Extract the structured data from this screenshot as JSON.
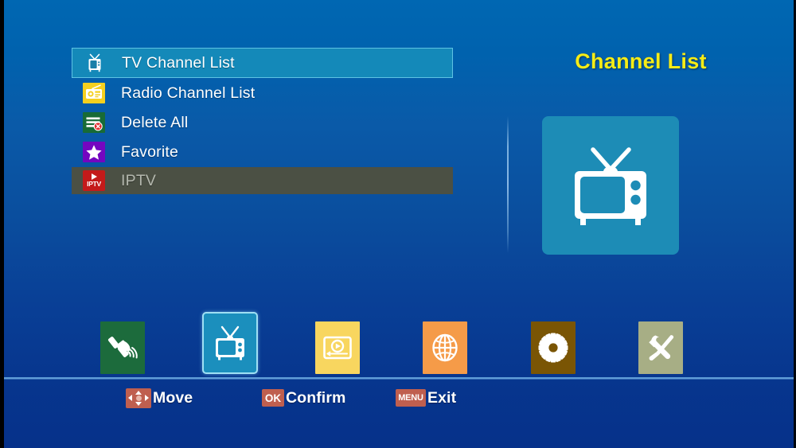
{
  "screen": {
    "background_top": "#0067b2",
    "background_bottom": "#06318a"
  },
  "menu": {
    "items": [
      {
        "label": "TV Channel List",
        "icon": "tv-icon",
        "state": "selected"
      },
      {
        "label": "Radio Channel List",
        "icon": "radio-icon",
        "state": "normal"
      },
      {
        "label": "Delete All",
        "icon": "delete-all-icon",
        "state": "normal"
      },
      {
        "label": "Favorite",
        "icon": "star-icon",
        "state": "normal"
      },
      {
        "label": "IPTV",
        "icon": "iptv-icon",
        "state": "disabled"
      }
    ],
    "selected_bg": "#1489b9",
    "disabled_bg": "#4b5044"
  },
  "panel": {
    "title": "Channel List",
    "title_color": "#f6ec16",
    "icon": "tv-icon",
    "tile_color": "#1d8cb6"
  },
  "iconbar": {
    "items": [
      {
        "name": "satellite-icon",
        "tile_color": "#1c6b3c",
        "active": false
      },
      {
        "name": "tv-icon",
        "tile_color": "#1b8fbd",
        "active": true
      },
      {
        "name": "media-player-icon",
        "tile_color": "#f8d65f",
        "active": false
      },
      {
        "name": "globe-icon",
        "tile_color": "#f59b48",
        "active": false
      },
      {
        "name": "gear-icon",
        "tile_color": "#7a5504",
        "active": false
      },
      {
        "name": "tools-icon",
        "tile_color": "#a7ae85",
        "active": false
      }
    ]
  },
  "footer": {
    "badge_color": "#bf5f4f",
    "hints": [
      {
        "key": "",
        "key_icon": "dpad-icon",
        "label": "Move"
      },
      {
        "key": "OK",
        "key_icon": "",
        "label": "Confirm"
      },
      {
        "key": "MENU",
        "key_icon": "",
        "label": "Exit"
      }
    ]
  }
}
